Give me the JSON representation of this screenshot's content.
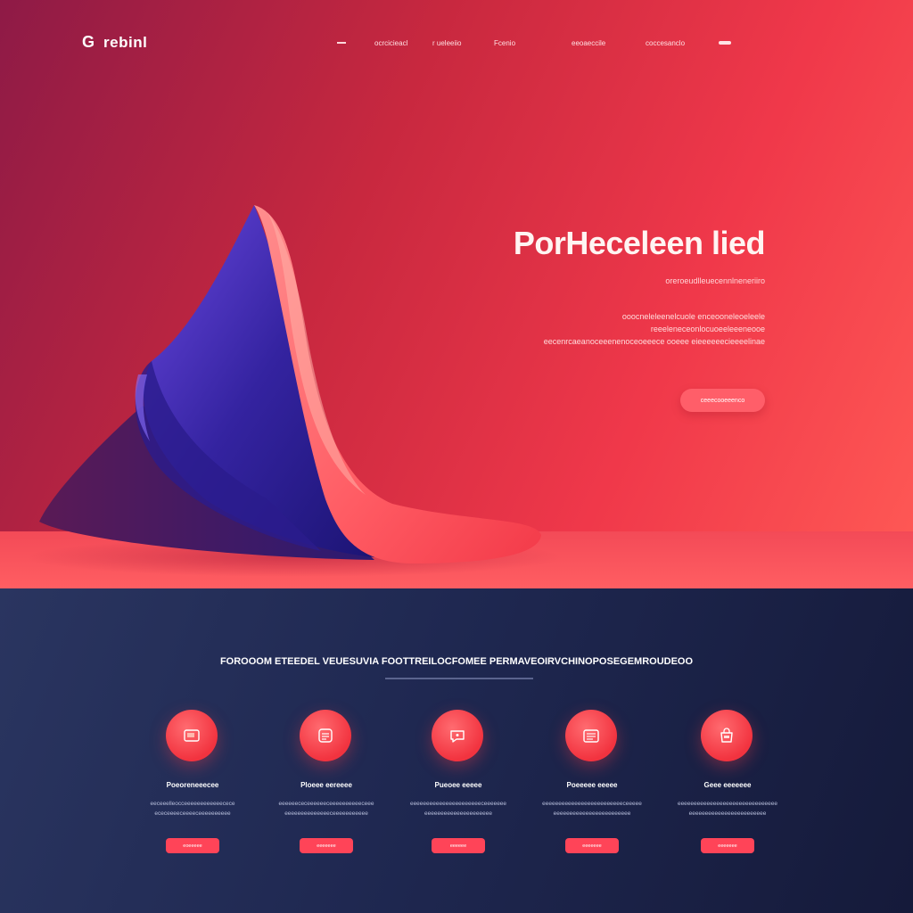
{
  "header": {
    "logo_mark": "G",
    "logo_text": "rebinl",
    "nav": [
      {
        "label": "ocrcicieacl"
      },
      {
        "label": "r ueleeiio"
      },
      {
        "label": "Fcenio"
      },
      {
        "label": "eeoaeccile"
      },
      {
        "label": "coccesanclo"
      }
    ]
  },
  "hero": {
    "title": "PorHeceleen lied",
    "subtitle": "oreroeudlleuecennlneneriiro",
    "body": "ooocneleleenelcuole enceooneleoeleele reeeleneceonlocuoeeleeeneooe eecenrcaeanoceeenenoceoeeece ooeee eieeeeeecieeeelinae",
    "cta_label": "ceeecooeeenco"
  },
  "features": {
    "heading": "FOROOOM ETEEDEL VEUESUVIA FOOTTREILOCFOMEE PERMAVEOIRVCHINOPOSEGEMROUDEOO",
    "cards": [
      {
        "icon": "card-icon",
        "title": "Poeoreneeecee",
        "desc": "eeceeelleocceeeeeeeeeeeecece ececeeeeceeeeceeeeeeeeee",
        "button": "eoeeeee"
      },
      {
        "icon": "list-icon",
        "title": "Ploeee eereeee",
        "desc": "eeeeeececeeeeeeceeeeeeeeeeceee eeeeeeeeeeeeeeceeeeeeeeeee",
        "button": "eeeeeee"
      },
      {
        "icon": "chat-icon",
        "title": "Pueoee eeeee",
        "desc": "eeeeeeeeeeeeeeeeeeeeeeceeeeeee eeeeeeeeeeeeeeeeeeeee",
        "button": "eeeeee"
      },
      {
        "icon": "document-icon",
        "title": "Poeeeee eeeee",
        "desc": "eeeeeeeeeeeeeeeeeeeeeeeeeceeeee eeeeeeeeeeeeeeeeeeeeeeee",
        "button": "eeeeeee"
      },
      {
        "icon": "bag-icon",
        "title": "Geee eeeeeee",
        "desc": "eeeeeeeeeeeeeeeeeeeeeeeeeeeeeee eeeeeeeeeeeeeeeeeeeeeeee",
        "button": "eeeeeee"
      }
    ]
  },
  "colors": {
    "hero_gradient_start": "#8e1a46",
    "hero_gradient_end": "#ff5a55",
    "accent": "#ff4458",
    "sculpture_purple": "#3d2aa8",
    "features_bg": "#1f2851"
  }
}
